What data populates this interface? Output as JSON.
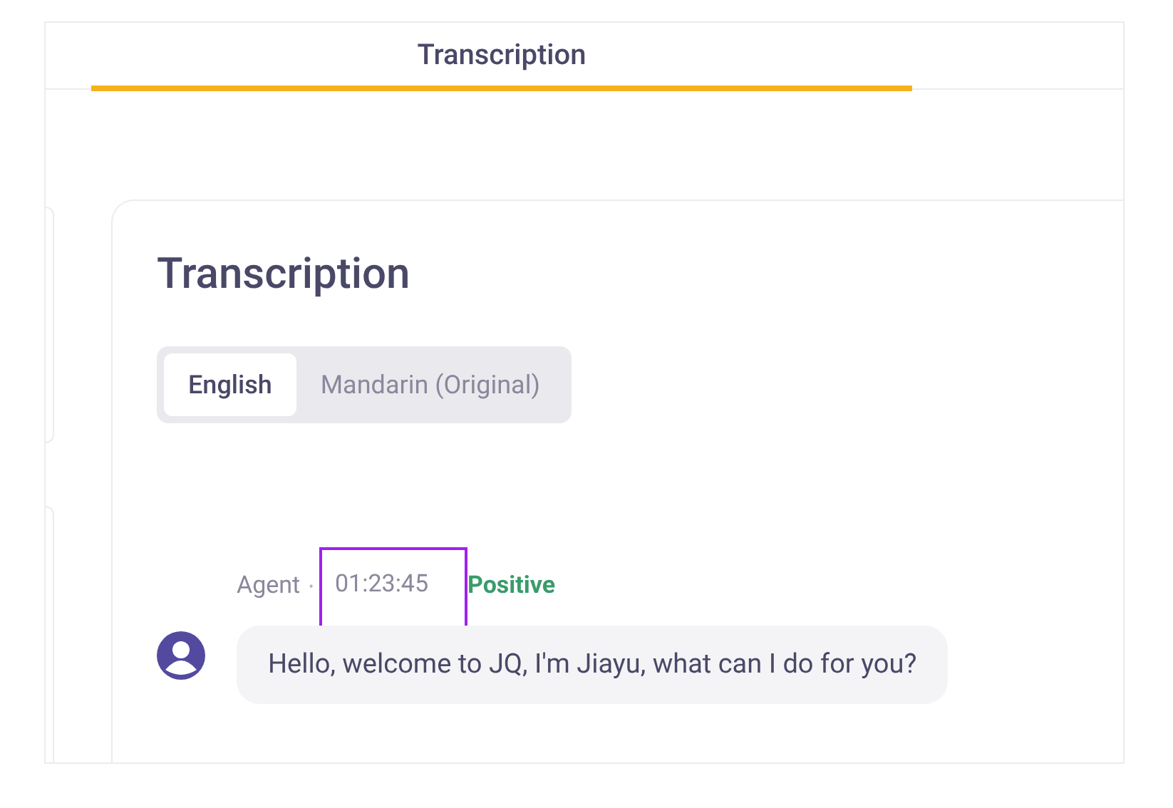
{
  "tabs": [
    {
      "label": "Transcription",
      "selected": true
    }
  ],
  "panel": {
    "title": "Transcription",
    "languages": [
      {
        "label": "English",
        "selected": true
      },
      {
        "label": "Mandarin (Original)",
        "selected": false
      }
    ],
    "messages": [
      {
        "speaker": "Agent",
        "separator": "•",
        "time": "01:23:45",
        "time_highlighted": true,
        "sentiment": "Positive",
        "text": "Hello, welcome to JQ, I'm Jiayu, what can I do for you?"
      }
    ]
  }
}
